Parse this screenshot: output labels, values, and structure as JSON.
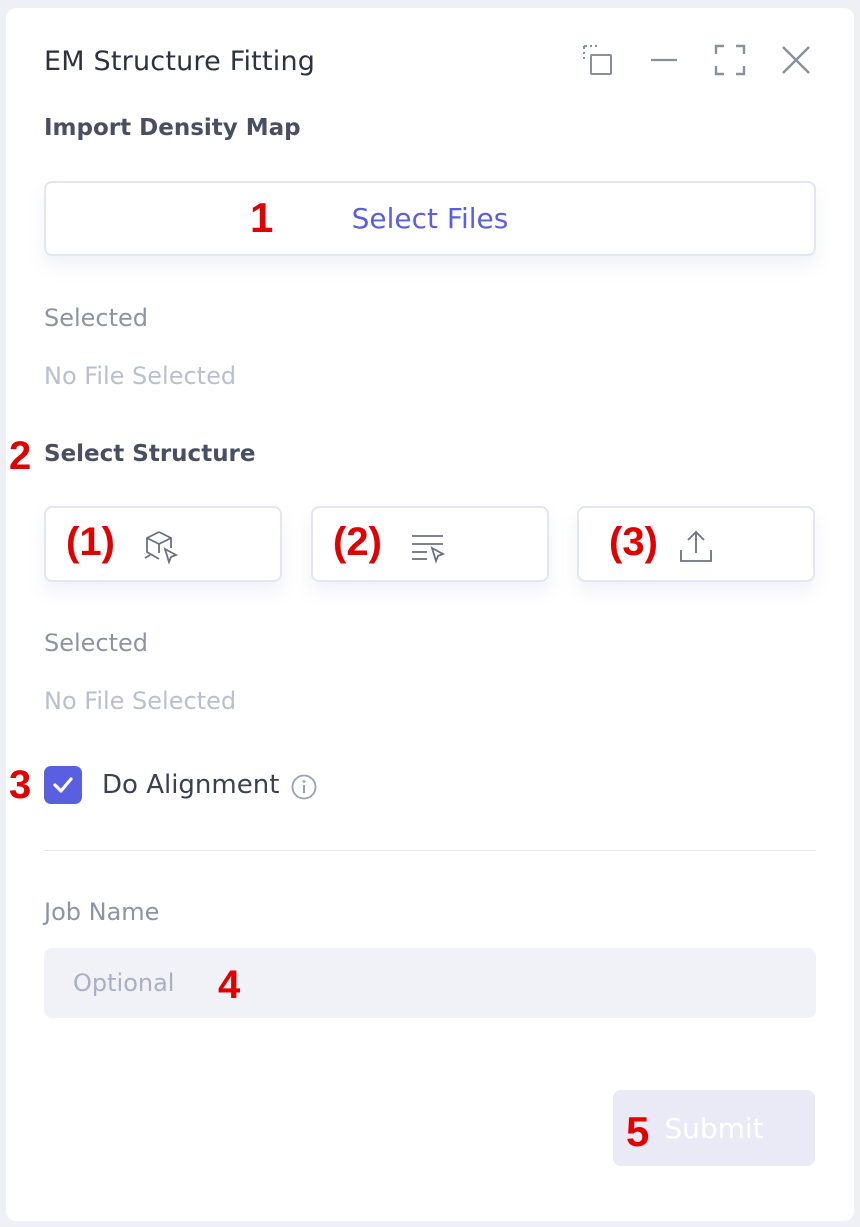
{
  "window": {
    "title": "EM Structure Fitting",
    "controls": [
      "popout-icon",
      "minimize-icon",
      "maximize-icon",
      "close-icon"
    ]
  },
  "density_map": {
    "heading": "Import Density Map",
    "select_files_label": "Select Files",
    "selected_label": "Selected",
    "selected_value": "No File Selected"
  },
  "structure": {
    "heading": "Select Structure",
    "buttons": [
      {
        "annotation": "(1)",
        "icon": "cube-select-icon"
      },
      {
        "annotation": "(2)",
        "icon": "list-select-icon"
      },
      {
        "annotation": "(3)",
        "icon": "upload-icon"
      }
    ],
    "selected_label": "Selected",
    "selected_value": "No File Selected"
  },
  "alignment": {
    "label": "Do Alignment",
    "checked": true,
    "info_icon": "info-icon"
  },
  "job": {
    "label": "Job Name",
    "placeholder": "Optional",
    "value": ""
  },
  "submit": {
    "label": "Submit",
    "enabled": false
  },
  "annotations": {
    "a1": "1",
    "a2": "2",
    "a3": "3",
    "a4": "4",
    "a5": "5"
  },
  "colors": {
    "accent": "#5a5fe0",
    "annotation": "#e00000",
    "submit_disabled_bg": "#e9eaf6"
  }
}
